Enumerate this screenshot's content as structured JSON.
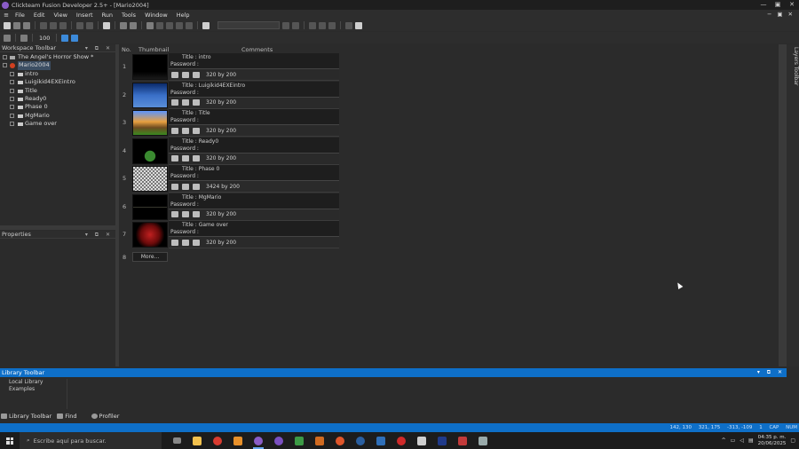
{
  "window": {
    "title": "Clickteam Fusion Developer 2.5+ - [Mario2004]",
    "controls": [
      "—",
      "▣",
      "✕"
    ]
  },
  "menu": {
    "items": [
      "File",
      "Edit",
      "View",
      "Insert",
      "Run",
      "Tools",
      "Window",
      "Help"
    ],
    "right": [
      "−",
      "▣",
      "✕"
    ]
  },
  "toolbar2": {
    "zoom": "100"
  },
  "workspace": {
    "title": "Workspace Toolbar",
    "root": "The Angel's Horror Show *",
    "app": "Mario2004",
    "frames": [
      "intro",
      "Luigikid4EXEintro",
      "Title",
      "Ready0",
      "Phase 0",
      "MgMario",
      "Game over"
    ]
  },
  "properties": {
    "title": "Properties"
  },
  "editor": {
    "col_no": "No.",
    "col_thumb": "Thumbnail",
    "col_comments": "Comments",
    "title_prefix": "Title : ",
    "password_label": "Password :",
    "by": "by",
    "frames": [
      {
        "no": "1",
        "title": "intro",
        "w": "320",
        "h": "200"
      },
      {
        "no": "2",
        "title": "Luigikid4EXEintro",
        "w": "320",
        "h": "200"
      },
      {
        "no": "3",
        "title": "Title",
        "w": "320",
        "h": "200"
      },
      {
        "no": "4",
        "title": "Ready0",
        "w": "320",
        "h": "200"
      },
      {
        "no": "5",
        "title": "Phase 0",
        "w": "3424",
        "h": "200"
      },
      {
        "no": "6",
        "title": "MgMario",
        "w": "320",
        "h": "200"
      },
      {
        "no": "7",
        "title": "Game over",
        "w": "320",
        "h": "200"
      }
    ],
    "more_no": "8",
    "more_label": "More..."
  },
  "layers": {
    "label": "Layers Toolbar"
  },
  "library": {
    "title": "Library Toolbar",
    "items": [
      "Local Library",
      "Examples"
    ]
  },
  "bottom_tabs": [
    "Library Toolbar",
    "Find",
    "Profiler"
  ],
  "status": {
    "cursor": "142, 130",
    "size": "321, 175",
    "delta": "-313, -109",
    "page": "1",
    "cap": "CAP",
    "num": "NUM"
  },
  "taskbar": {
    "search_placeholder": "Escribe aquí para buscar.",
    "time": "04:35 p. m.",
    "date": "20/06/2025"
  },
  "colors": {
    "accent": "#0e6fc8",
    "panel": "#2b2b2b",
    "selection": "#3c4e63"
  }
}
